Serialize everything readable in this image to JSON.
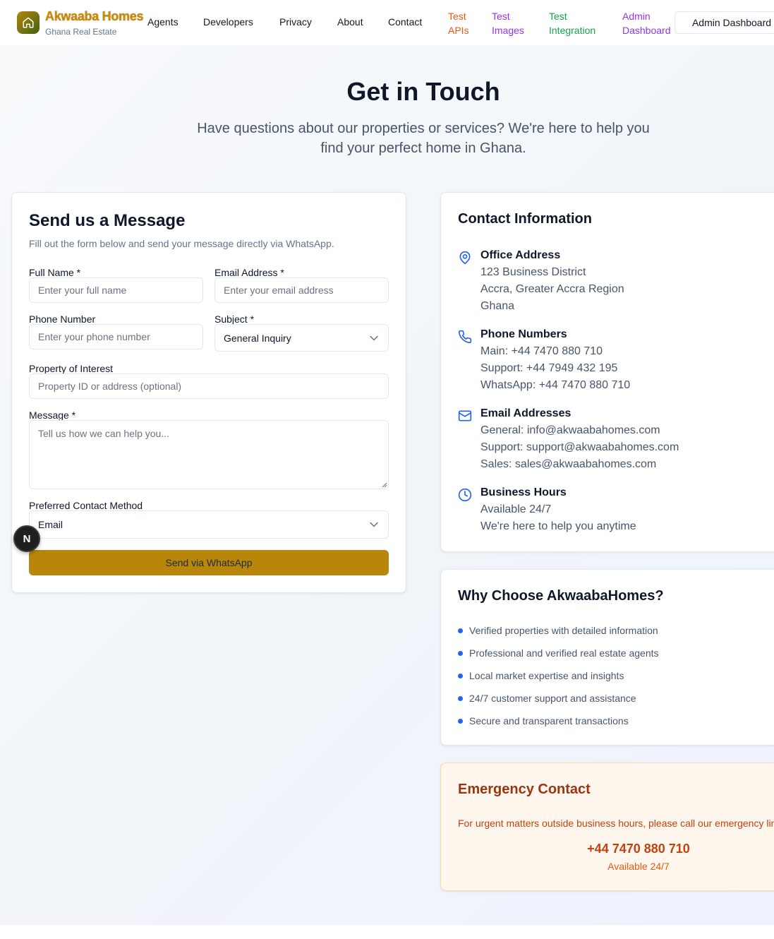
{
  "nav": {
    "brand_name": "Akwaaba Homes",
    "brand_sub": "Ghana Real Estate",
    "links": [
      "Agents",
      "Developers",
      "Privacy",
      "About",
      "Contact"
    ],
    "test_links": [
      {
        "label": "Test APIs",
        "color": "#ea580c"
      },
      {
        "label": "Test Images",
        "color": "#9333ea"
      },
      {
        "label": "Test Integration",
        "color": "#16a34a"
      },
      {
        "label": "Admin Dashboard",
        "color": "#9333ea"
      }
    ],
    "admin_button": "Admin Dashboard"
  },
  "hero": {
    "title": "Get in Touch",
    "subtitle": "Have questions about our properties or services? We're here to help you find your perfect home in Ghana."
  },
  "form": {
    "title": "Send us a Message",
    "description": "Fill out the form below and send your message directly via WhatsApp.",
    "full_name_label": "Full Name *",
    "full_name_placeholder": "Enter your full name",
    "email_label": "Email Address *",
    "email_placeholder": "Enter your email address",
    "phone_label": "Phone Number",
    "phone_placeholder": "Enter your phone number",
    "subject_label": "Subject *",
    "subject_value": "General Inquiry",
    "property_label": "Property of Interest",
    "property_placeholder": "Property ID or address (optional)",
    "message_label": "Message *",
    "message_placeholder": "Tell us how we can help you...",
    "contact_method_label": "Preferred Contact Method",
    "contact_method_value": "Email",
    "submit_label": "Send via WhatsApp"
  },
  "overlay_badge": "N",
  "contact_info": {
    "title": "Contact Information",
    "office": {
      "heading": "Office Address",
      "lines": [
        "123 Business District",
        "Accra, Greater Accra Region",
        "Ghana"
      ]
    },
    "phones": {
      "heading": "Phone Numbers",
      "lines": [
        "Main: +44 7470 880 710",
        "Support: +44 7949 432 195",
        "WhatsApp: +44 7470 880 710"
      ]
    },
    "emails": {
      "heading": "Email Addresses",
      "lines": [
        "General: info@akwaabahomes.com",
        "Support: support@akwaabahomes.com",
        "Sales: sales@akwaabahomes.com"
      ]
    },
    "hours": {
      "heading": "Business Hours",
      "lines": [
        "Available 24/7",
        "We're here to help you anytime"
      ]
    },
    "icon_color": "#2563eb"
  },
  "why": {
    "title": "Why Choose AkwaabaHomes?",
    "items": [
      "Verified properties with detailed information",
      "Professional and verified real estate agents",
      "Local market expertise and insights",
      "24/7 customer support and assistance",
      "Secure and transparent transactions"
    ]
  },
  "emergency": {
    "title": "Emergency Contact",
    "description": "For urgent matters outside business hours, please call our emergency line:",
    "phone": "+44 7470 880 710",
    "availability": "Available 24/7"
  },
  "colors": {
    "brand_gold": "#b8860b",
    "accent_blue": "#2563eb",
    "emergency_orange": "#c2410c"
  }
}
